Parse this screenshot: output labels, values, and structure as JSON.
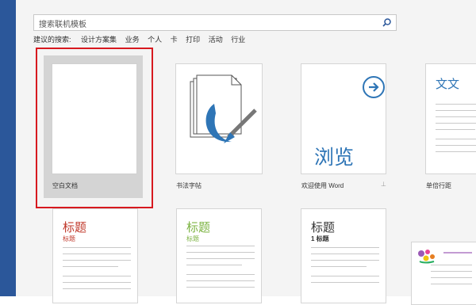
{
  "search": {
    "placeholder": "搜索联机模板"
  },
  "suggested": {
    "label": "建议的搜索:",
    "items": [
      "设计方案集",
      "业务",
      "个人",
      "卡",
      "打印",
      "活动",
      "行业"
    ]
  },
  "templates": [
    {
      "caption": "空白文档"
    },
    {
      "caption": "书法字帖"
    },
    {
      "caption": "欢迎使用 Word",
      "preview_text": "浏览"
    },
    {
      "caption": "单倍行距",
      "preview_text": "文文"
    },
    {
      "title": "标题",
      "subtitle": "标题"
    },
    {
      "title": "标题",
      "subtitle": "标题"
    },
    {
      "title": "标题",
      "subtitle": "1  标题"
    },
    {
      "title": ""
    }
  ],
  "colors": {
    "accent": "#2b579a",
    "selection": "#d7191f",
    "red_title": "#c0392b",
    "green_title": "#7cb342",
    "blue": "#2e75b6"
  }
}
